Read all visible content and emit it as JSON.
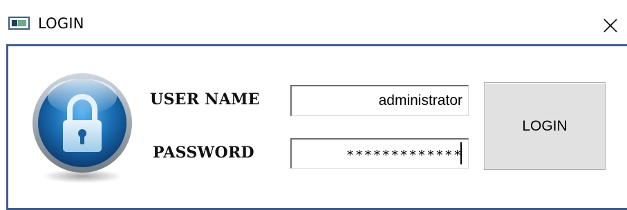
{
  "window": {
    "title": "LOGIN",
    "icon": "application-window-icon",
    "close_icon": "close-icon"
  },
  "form": {
    "username_label": "USER NAME",
    "username_value": "administrator",
    "password_label": "PASSWORD",
    "password_value": "*************",
    "login_button_label": "LOGIN",
    "lock_icon": "padlock-icon"
  },
  "colors": {
    "client_border": "#3f5f8a",
    "lock_blue": "#1a6fb5",
    "button_face": "#e1e1e1"
  }
}
